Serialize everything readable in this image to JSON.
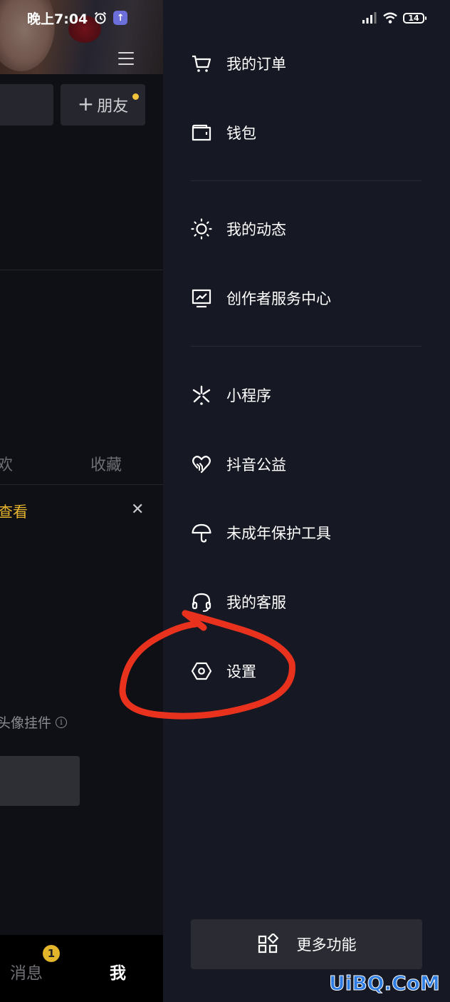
{
  "status_bar": {
    "time": "晚上7:04",
    "battery": "14"
  },
  "profile": {
    "add_friend_label": "朋友",
    "tabs": {
      "likes_partial": "欢",
      "favorites": "收藏"
    },
    "notice_text": "查看",
    "widget_text": "头像挂件"
  },
  "bottom_nav": {
    "messages_label": "消息",
    "messages_badge": "1",
    "me_label": "我"
  },
  "drawer": {
    "items": [
      {
        "label": "我的订单",
        "icon": "cart-icon"
      },
      {
        "label": "钱包",
        "icon": "wallet-icon"
      },
      {
        "label": "我的动态",
        "icon": "sun-icon"
      },
      {
        "label": "创作者服务中心",
        "icon": "monitor-chart-icon"
      },
      {
        "label": "小程序",
        "icon": "mini-program-icon"
      },
      {
        "label": "抖音公益",
        "icon": "heart-hands-icon"
      },
      {
        "label": "未成年保护工具",
        "icon": "umbrella-icon"
      },
      {
        "label": "我的客服",
        "icon": "headset-icon"
      },
      {
        "label": "设置",
        "icon": "hexagon-settings-icon"
      }
    ],
    "more_label": "更多功能"
  },
  "watermark": "UiBQ.CoM",
  "colors": {
    "drawer_bg": "#161823",
    "accent_yellow": "#e5b32e",
    "annotation_red": "#e8321e"
  }
}
